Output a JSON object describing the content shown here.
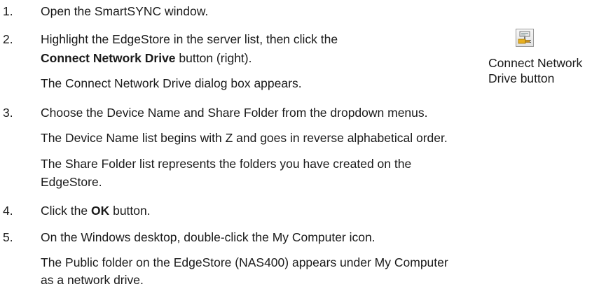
{
  "steps": [
    {
      "number": "1.",
      "lines": [
        "Open the SmartSYNC window."
      ]
    },
    {
      "number": "2.",
      "line1_pre": "Highlight the EdgeStore in the server list, then click the",
      "line2_bold": "Connect Network Drive",
      "line2_post": " button (right).",
      "note": "The Connect Network Drive dialog box appears."
    },
    {
      "number": "3.",
      "line1": "Choose the Device Name and Share Folder from the dropdown menus.",
      "note1": "The Device Name list begins with Z and goes in reverse alphabetical order.",
      "note2_a": "The Share Folder list represents the folders you have created on the",
      "note2_b": "EdgeStore."
    },
    {
      "number": "4.",
      "pre": "Click the ",
      "bold": "OK",
      "post": " button."
    },
    {
      "number": "5.",
      "line1": "On the Windows desktop, double-click the My Computer icon.",
      "note_a": "The Public folder on the EdgeStore (NAS400) appears under My Computer",
      "note_b": "as a network drive."
    }
  ],
  "side_figure": {
    "icon": "connect-network-drive-icon",
    "caption_line1": "Connect Network",
    "caption_line2": "Drive button"
  },
  "colors": {
    "text": "#1a1a1a",
    "icon_yellow": "#e8b020",
    "icon_plug": "#c89020"
  }
}
